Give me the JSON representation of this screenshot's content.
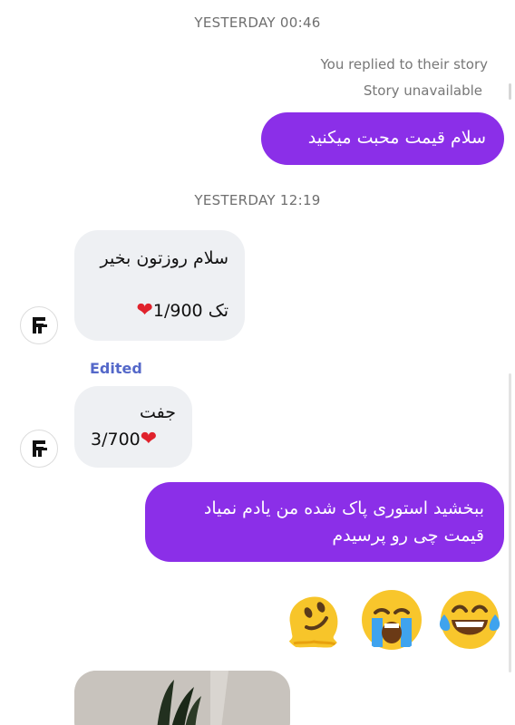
{
  "conversation": {
    "timestamp_1": "YESTERDAY 00:46",
    "story_reply_note": "You replied to their story",
    "story_unavailable": "Story unavailable",
    "msg_out_1": "سلام قیمت محبت میکنید",
    "timestamp_2": "YESTERDAY 12:19",
    "msg_in_1_line1": "سلام روزتون بخیر",
    "msg_in_1_line2": "تک 1/900",
    "edited_label": "Edited",
    "msg_in_2_line1": "جفت",
    "msg_in_2_line2": "3/700",
    "msg_out_2_line1": "ببخشید استوری پاک شده من یادم نمیاد",
    "msg_out_2_line2": "قیمت چی رو پرسیدم",
    "emojis": [
      "melting-face",
      "loudly-crying-face",
      "face-with-tears-of-joy"
    ]
  },
  "colors": {
    "outgoing_bubble": "#8b2fe8",
    "incoming_bubble": "#eef0f3",
    "edited_label": "#5468c9",
    "heart": "#e0222c"
  }
}
